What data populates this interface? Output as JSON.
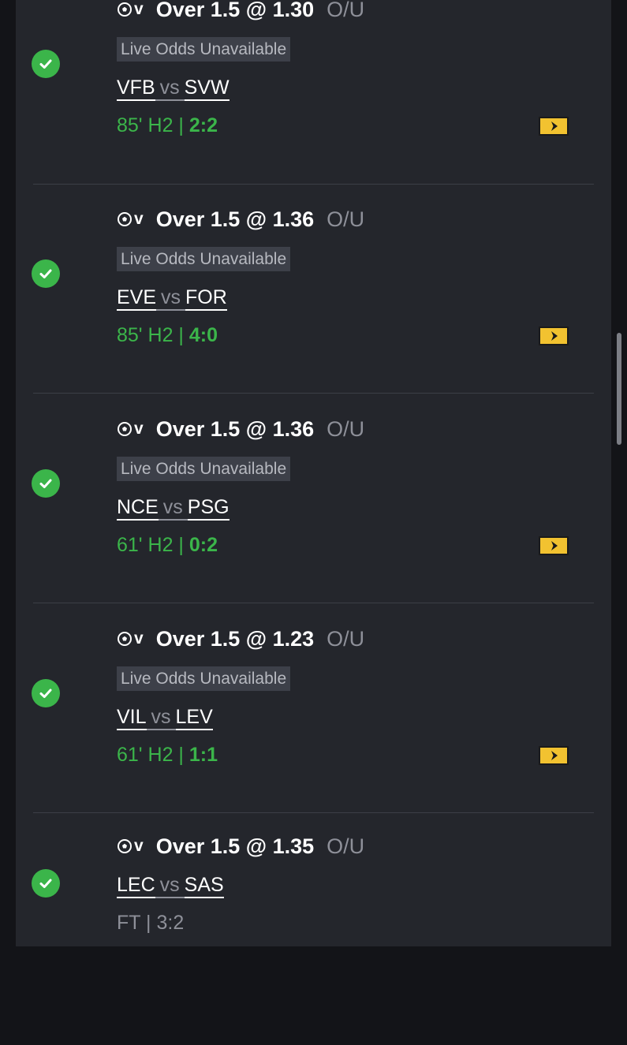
{
  "colors": {
    "background": "#131418",
    "panel": "#24262c",
    "win_green": "#3bb54a",
    "live_yellow": "#f2c230",
    "muted_text": "#8e9099"
  },
  "bets": [
    {
      "sport_icon": "soccer-ball-icon",
      "sport_letter": "v",
      "market": "Over 1.5 @ 1.30",
      "type": "O/U",
      "odds_notice": "Live Odds Unavailable",
      "home": "VFB",
      "vs": "vs",
      "away": "SVW",
      "status_prefix": "85' H2 | ",
      "score": "2:2",
      "result": "won",
      "live_icon": "live-stream-icon"
    },
    {
      "sport_icon": "soccer-ball-icon",
      "sport_letter": "v",
      "market": "Over 1.5 @ 1.36",
      "type": "O/U",
      "odds_notice": "Live Odds Unavailable",
      "home": "EVE",
      "vs": "vs",
      "away": "FOR",
      "status_prefix": "85' H2 | ",
      "score": "4:0",
      "result": "won",
      "live_icon": "live-stream-icon"
    },
    {
      "sport_icon": "soccer-ball-icon",
      "sport_letter": "v",
      "market": "Over 1.5 @ 1.36",
      "type": "O/U",
      "odds_notice": "Live Odds Unavailable",
      "home": "NCE",
      "vs": "vs",
      "away": "PSG",
      "status_prefix": "61' H2 | ",
      "score": "0:2",
      "result": "won",
      "live_icon": "live-stream-icon"
    },
    {
      "sport_icon": "soccer-ball-icon",
      "sport_letter": "v",
      "market": "Over 1.5 @ 1.23",
      "type": "O/U",
      "odds_notice": "Live Odds Unavailable",
      "home": "VIL",
      "vs": "vs",
      "away": "LEV",
      "status_prefix": "61' H2 | ",
      "score": "1:1",
      "result": "won",
      "live_icon": "live-stream-icon"
    },
    {
      "sport_icon": "soccer-ball-icon",
      "sport_letter": "v",
      "market": "Over 1.5 @ 1.35",
      "type": "O/U",
      "home": "LEC",
      "vs": "vs",
      "away": "SAS",
      "status_prefix": "FT | ",
      "score": "3:2",
      "result": "won"
    }
  ]
}
